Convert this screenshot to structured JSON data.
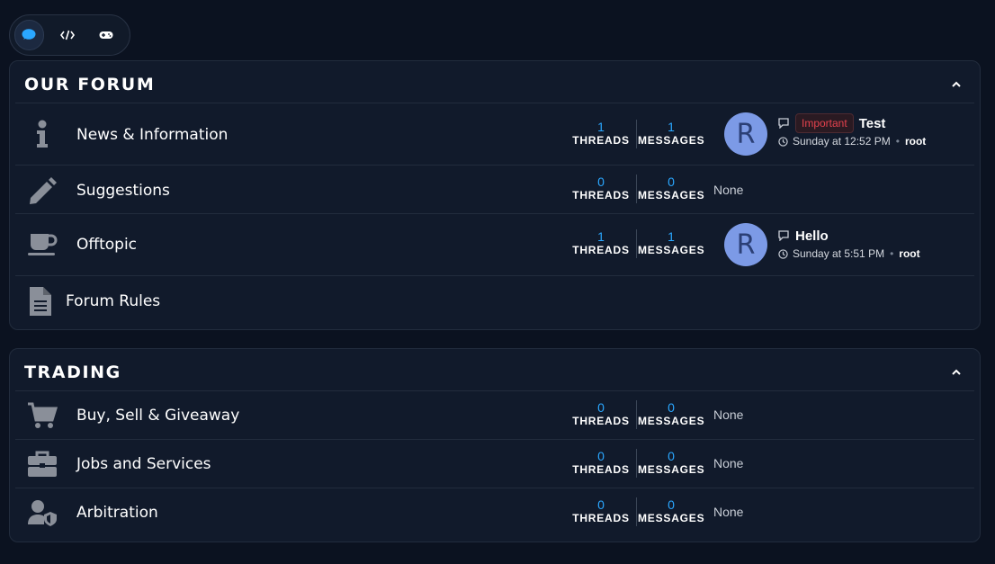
{
  "tabs": [
    {
      "icon": "comment-icon",
      "active": true
    },
    {
      "icon": "code-icon",
      "active": false
    },
    {
      "icon": "gamepad-icon",
      "active": false
    }
  ],
  "colors": {
    "background": "#0b1220",
    "panel": "#111a2b",
    "accent": "#2aa7ff",
    "avatar": "#7c9ae6",
    "prefix_important": "#e4424d"
  },
  "categories": [
    {
      "title": "OUR FORUM",
      "nodes": [
        {
          "title": "News & Information",
          "icon": "info-icon",
          "threads": "1",
          "messages": "1",
          "threads_label": "THREADS",
          "messages_label": "MESSAGES",
          "last_post": {
            "avatar_letter": "R",
            "prefix": "Important",
            "title": "Test",
            "time": "Sunday at 12:52 PM",
            "user": "root"
          }
        },
        {
          "title": "Suggestions",
          "icon": "pencil-icon",
          "threads": "0",
          "messages": "0",
          "threads_label": "THREADS",
          "messages_label": "MESSAGES",
          "none": "None"
        },
        {
          "title": "Offtopic",
          "icon": "coffee-icon",
          "threads": "1",
          "messages": "1",
          "threads_label": "THREADS",
          "messages_label": "MESSAGES",
          "last_post": {
            "avatar_letter": "R",
            "title": "Hello",
            "time": "Sunday at 5:51 PM",
            "user": "root"
          }
        },
        {
          "title": "Forum Rules",
          "icon": "document-icon"
        }
      ]
    },
    {
      "title": "TRADING",
      "nodes": [
        {
          "title": "Buy, Sell & Giveaway",
          "icon": "cart-icon",
          "threads": "0",
          "messages": "0",
          "threads_label": "THREADS",
          "messages_label": "MESSAGES",
          "none": "None"
        },
        {
          "title": "Jobs and Services",
          "icon": "briefcase-icon",
          "threads": "0",
          "messages": "0",
          "threads_label": "THREADS",
          "messages_label": "MESSAGES",
          "none": "None"
        },
        {
          "title": "Arbitration",
          "icon": "user-shield-icon",
          "threads": "0",
          "messages": "0",
          "threads_label": "THREADS",
          "messages_label": "MESSAGES",
          "none": "None"
        }
      ]
    }
  ]
}
